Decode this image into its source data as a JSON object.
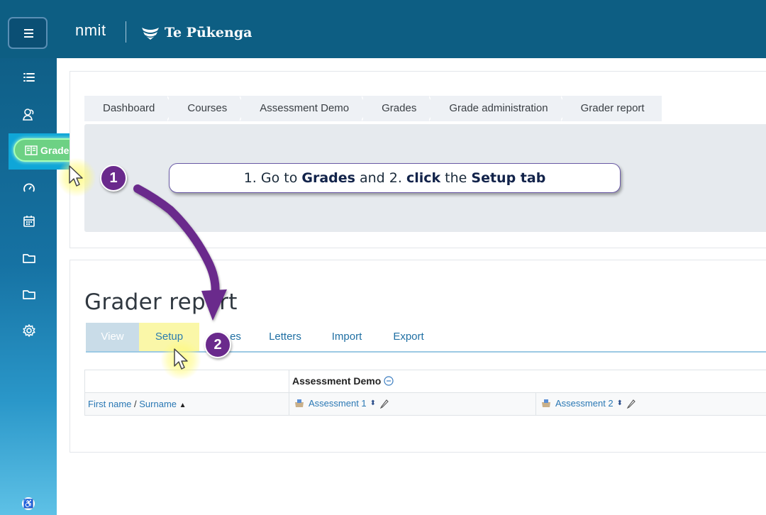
{
  "header": {
    "logo_primary": "nmit",
    "logo_secondary": "Te Pūkenga"
  },
  "sidebar": {
    "items": [
      {
        "icon": "list-icon"
      },
      {
        "icon": "users-icon"
      },
      {
        "icon": "grades-book-icon",
        "label": "Grades"
      },
      {
        "icon": "gauge-icon"
      },
      {
        "icon": "calendar-icon"
      },
      {
        "icon": "folder-icon"
      },
      {
        "icon": "folder-icon"
      },
      {
        "icon": "gear-icon"
      }
    ],
    "highlight_label": "Grades",
    "accessibility_icon": "accessibility-icon"
  },
  "breadcrumb": [
    "Dashboard",
    "Courses",
    "Assessment Demo",
    "Grades",
    "Grade administration",
    "Grader report"
  ],
  "callout": {
    "part1": "1. Go to ",
    "bold1": "Grades",
    "part2": " and 2. ",
    "bold2": "click",
    "part3": " the ",
    "bold3": "Setup tab"
  },
  "page_title": "Grader report",
  "tabs": [
    "View",
    "Setup",
    "Scales",
    "Letters",
    "Import",
    "Export"
  ],
  "tabs_visible": {
    "scales_fragment": "es"
  },
  "table": {
    "category_header": "Assessment Demo",
    "name_col": {
      "first": "First name",
      "sep": " / ",
      "last": "Surname"
    },
    "items": [
      "Assessment 1",
      "Assessment 2"
    ]
  },
  "annotations": {
    "step1": "1",
    "step2": "2",
    "arrow_color": "#6a2a8c",
    "highlight_color": "#faf7a8"
  },
  "colors": {
    "topbar": "#0d5e83",
    "accent": "#1f6fa3",
    "grades_pill": "#6dd184"
  }
}
